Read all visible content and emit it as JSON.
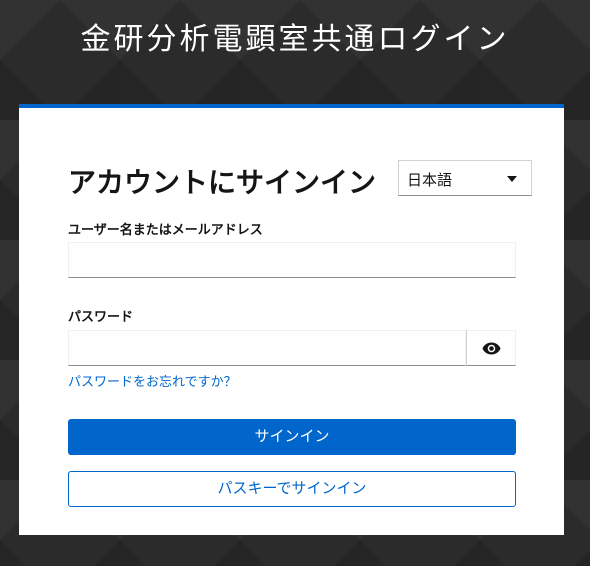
{
  "header": {
    "title": "金研分析電顕室共通ログイン"
  },
  "login": {
    "title": "アカウントにサインイン",
    "language": {
      "selected": "日本語"
    },
    "username": {
      "label": "ユーザー名またはメールアドレス",
      "value": "",
      "placeholder": ""
    },
    "password": {
      "label": "パスワード",
      "value": "",
      "placeholder": ""
    },
    "forgot_password": "パスワードをお忘れですか？",
    "sign_in_button": "サインイン",
    "passkey_button": "パスキーでサインイン"
  },
  "icons": {
    "password_toggle": "eye-icon",
    "language_caret": "caret-down-icon"
  },
  "colors": {
    "accent": "#0066cc",
    "background": "#2b2b2b",
    "card": "#ffffff"
  }
}
